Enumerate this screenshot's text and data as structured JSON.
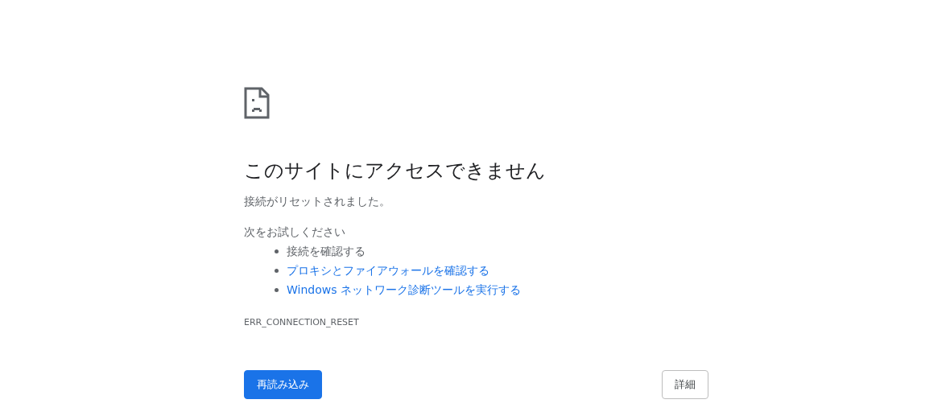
{
  "error_page": {
    "heading": "このサイトにアクセスできません",
    "message": "接続がリセットされました。",
    "suggestions_heading": "次をお試しください",
    "suggestions": [
      {
        "text": "接続を確認する",
        "kind": "text"
      },
      {
        "text": "プロキシとファイアウォールを確認する",
        "kind": "link"
      },
      {
        "text": "Windows ネットワーク診断ツールを実行する",
        "kind": "link"
      }
    ],
    "error_code": "ERR_CONNECTION_RESET",
    "buttons": [
      {
        "label": "再読み込み",
        "kind": "primary"
      },
      {
        "label": "詳細",
        "kind": "secondary"
      }
    ]
  }
}
